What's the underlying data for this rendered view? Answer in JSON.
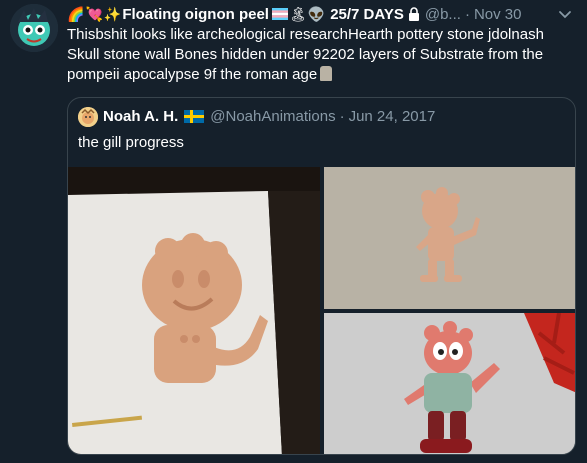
{
  "tweet": {
    "author_name": "Floating oignon peel",
    "name_emojis_before": [
      "rainbow-emoji",
      "heart-emoji",
      "sparkles-emoji"
    ],
    "name_emojis_after": [
      "trans-flag-emoji",
      "island-emoji",
      "alien-emoji"
    ],
    "status": "25/7 DAYS",
    "handle": "@b...",
    "separator": "·",
    "date": "Nov 30",
    "text": "Thisbshit looks like archeological researchHearth pottery stone jdolnash Skull stone wall  Bones hidden under 92202 layers of Substrate from the pompeii apocalypse 9f the roman age"
  },
  "quoted": {
    "author_name": "Noah A. H.",
    "handle": "@NoahAnimations",
    "separator": "·",
    "date": "Jun 24, 2017",
    "text": "the gill progress"
  },
  "colors": {
    "background": "#15202b",
    "secondary_text": "#8899a6",
    "border": "#38444d"
  }
}
